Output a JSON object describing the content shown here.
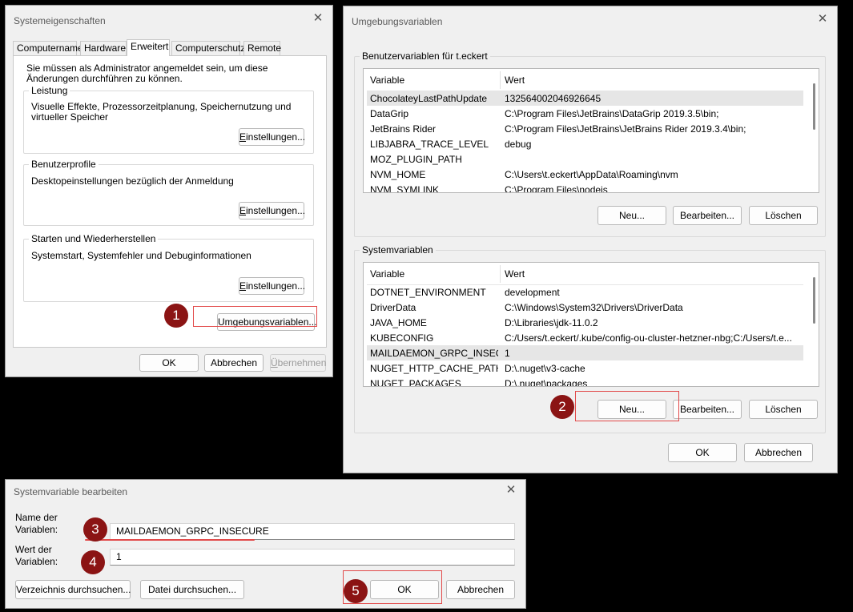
{
  "sysprops": {
    "title": "Systemeigenschaften",
    "tabs": [
      "Computername",
      "Hardware",
      "Erweitert",
      "Computerschutz",
      "Remote"
    ],
    "admin_note": "Sie müssen als Administrator angemeldet sein, um diese Änderungen durchführen zu können.",
    "perf": {
      "title": "Leistung",
      "desc": "Visuelle Effekte, Prozessorzeitplanung, Speichernutzung und virtueller Speicher",
      "button": "Einstellungen..."
    },
    "profiles": {
      "title": "Benutzerprofile",
      "desc": "Desktopeinstellungen bezüglich der Anmeldung",
      "button": "Einstellungen..."
    },
    "startup": {
      "title": "Starten und Wiederherstellen",
      "desc": "Systemstart, Systemfehler und Debuginformationen",
      "button": "Einstellungen..."
    },
    "envvars_button": "Umgebungsvariablen...",
    "ok": "OK",
    "cancel": "Abbrechen",
    "apply": "Übernehmen"
  },
  "envvars": {
    "title": "Umgebungsvariablen",
    "user_group": "Benutzervariablen für t.eckert",
    "user_headers": {
      "variable": "Variable",
      "value": "Wert"
    },
    "user_rows": [
      {
        "name": "ChocolateyLastPathUpdate",
        "value": "132564002046926645"
      },
      {
        "name": "DataGrip",
        "value": "C:\\Program Files\\JetBrains\\DataGrip 2019.3.5\\bin;"
      },
      {
        "name": "JetBrains Rider",
        "value": "C:\\Program Files\\JetBrains\\JetBrains Rider 2019.3.4\\bin;"
      },
      {
        "name": "LIBJABRA_TRACE_LEVEL",
        "value": "debug"
      },
      {
        "name": "MOZ_PLUGIN_PATH",
        "value": ""
      },
      {
        "name": "NVM_HOME",
        "value": "C:\\Users\\t.eckert\\AppData\\Roaming\\nvm"
      },
      {
        "name": "NVM_SYMLINK",
        "value": "C:\\Program Files\\nodejs"
      }
    ],
    "user_buttons": {
      "new": "Neu...",
      "edit": "Bearbeiten...",
      "delete": "Löschen"
    },
    "sys_group": "Systemvariablen",
    "sys_headers": {
      "variable": "Variable",
      "value": "Wert"
    },
    "sys_rows": [
      {
        "name": "DOTNET_ENVIRONMENT",
        "value": "development"
      },
      {
        "name": "DriverData",
        "value": "C:\\Windows\\System32\\Drivers\\DriverData"
      },
      {
        "name": "JAVA_HOME",
        "value": "D:\\Libraries\\jdk-11.0.2"
      },
      {
        "name": "KUBECONFIG",
        "value": "C:/Users/t.eckert/.kube/config-ou-cluster-hetzner-nbg;C:/Users/t.e..."
      },
      {
        "name": "MAILDAEMON_GRPC_INSEC...",
        "value": "1"
      },
      {
        "name": "NUGET_HTTP_CACHE_PATH",
        "value": "D:\\.nuget\\v3-cache"
      },
      {
        "name": "NUGET_PACKAGES",
        "value": "D:\\.nuget\\packages"
      }
    ],
    "sys_buttons": {
      "new": "Neu...",
      "edit": "Bearbeiten...",
      "delete": "Löschen"
    },
    "ok": "OK",
    "cancel": "Abbrechen"
  },
  "editvar": {
    "title": "Systemvariable bearbeiten",
    "name_label": "Name der Variablen:",
    "name_value": "MAILDAEMON_GRPC_INSECURE",
    "value_label": "Wert der Variablen:",
    "value_value": "1",
    "browse_dir": "Verzeichnis durchsuchen...",
    "browse_file": "Datei durchsuchen...",
    "ok": "OK",
    "cancel": "Abbrechen"
  },
  "badges": [
    "1",
    "2",
    "3",
    "4",
    "5"
  ],
  "colors": {
    "highlight": "#e24a4a",
    "badge": "#8b1414",
    "dialog_bg": "#f0f0f0"
  }
}
